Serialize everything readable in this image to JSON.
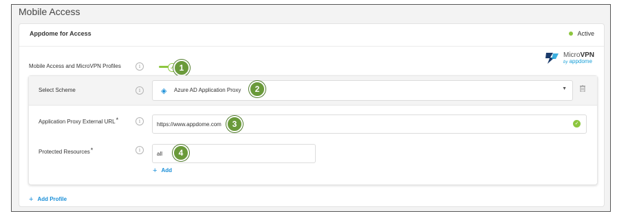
{
  "section_title": "Mobile Access",
  "card": {
    "title": "Appdome for Access",
    "status_text": "Active",
    "status_color": "#8dc63f"
  },
  "profiles_row": {
    "label": "Mobile Access and MicroVPN Profiles",
    "toggle_on": true,
    "callout": "1"
  },
  "logo": {
    "text_light": "Micro",
    "text_bold": "VPN",
    "sub_text": "appdome",
    "sub_prefix": "by"
  },
  "scheme": {
    "label": "Select Scheme",
    "selected_icon": "azure-diamond-icon",
    "selected_value": "Azure AD Application Proxy",
    "callout": "2"
  },
  "external_url": {
    "label": "Application Proxy External URL",
    "required_mark": "*",
    "value": "https://www.appdome.com",
    "callout": "3",
    "valid": true
  },
  "protected_resources": {
    "label": "Protected Resources",
    "required_mark": "*",
    "value": "all",
    "callout": "4",
    "add_label": "Add"
  },
  "add_profile_label": "Add Profile",
  "colors": {
    "accent_green": "#8dc63f",
    "link_blue": "#1a8fd8",
    "callout_green": "#6a9a3a"
  }
}
